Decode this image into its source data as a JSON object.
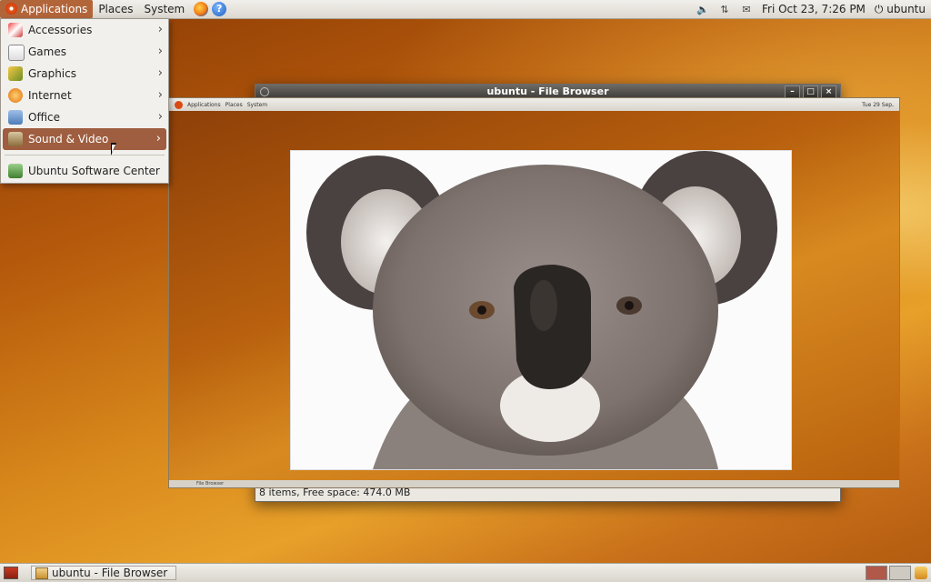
{
  "top_panel": {
    "menus": [
      "Applications",
      "Places",
      "System"
    ],
    "launchers": [
      "firefox-icon",
      "help-icon"
    ],
    "tray": [
      "volume-icon",
      "network-icon",
      "mail-icon"
    ],
    "clock": "Fri Oct 23,  7:26 PM",
    "user": "ubuntu",
    "help_glyph": "?"
  },
  "app_menu": {
    "items": [
      {
        "label": "Accessories",
        "icon": "accessories-icon",
        "submenu": true
      },
      {
        "label": "Games",
        "icon": "games-icon",
        "submenu": true
      },
      {
        "label": "Graphics",
        "icon": "graphics-icon",
        "submenu": true
      },
      {
        "label": "Internet",
        "icon": "internet-icon",
        "submenu": true
      },
      {
        "label": "Office",
        "icon": "office-icon",
        "submenu": true
      },
      {
        "label": "Sound & Video",
        "icon": "sound-video-icon",
        "submenu": true,
        "selected": true
      }
    ],
    "footer_item": {
      "label": "Ubuntu Software Center",
      "icon": "software-center-icon"
    },
    "arrow": "›"
  },
  "window": {
    "title": "ubuntu - File Browser",
    "status": "8 items, Free space: 474.0 MB",
    "buttons": {
      "minimize": "–",
      "maximize": "□",
      "close": "×"
    }
  },
  "embedded_screenshot": {
    "menus": [
      "Applications",
      "Places",
      "System"
    ],
    "clock": "Tue 29 Sep,",
    "task": "File Browser"
  },
  "bottom_panel": {
    "task_label": "ubuntu - File Browser"
  },
  "colors": {
    "accent": "#9e5e3f",
    "panel": "#e6e2db"
  }
}
